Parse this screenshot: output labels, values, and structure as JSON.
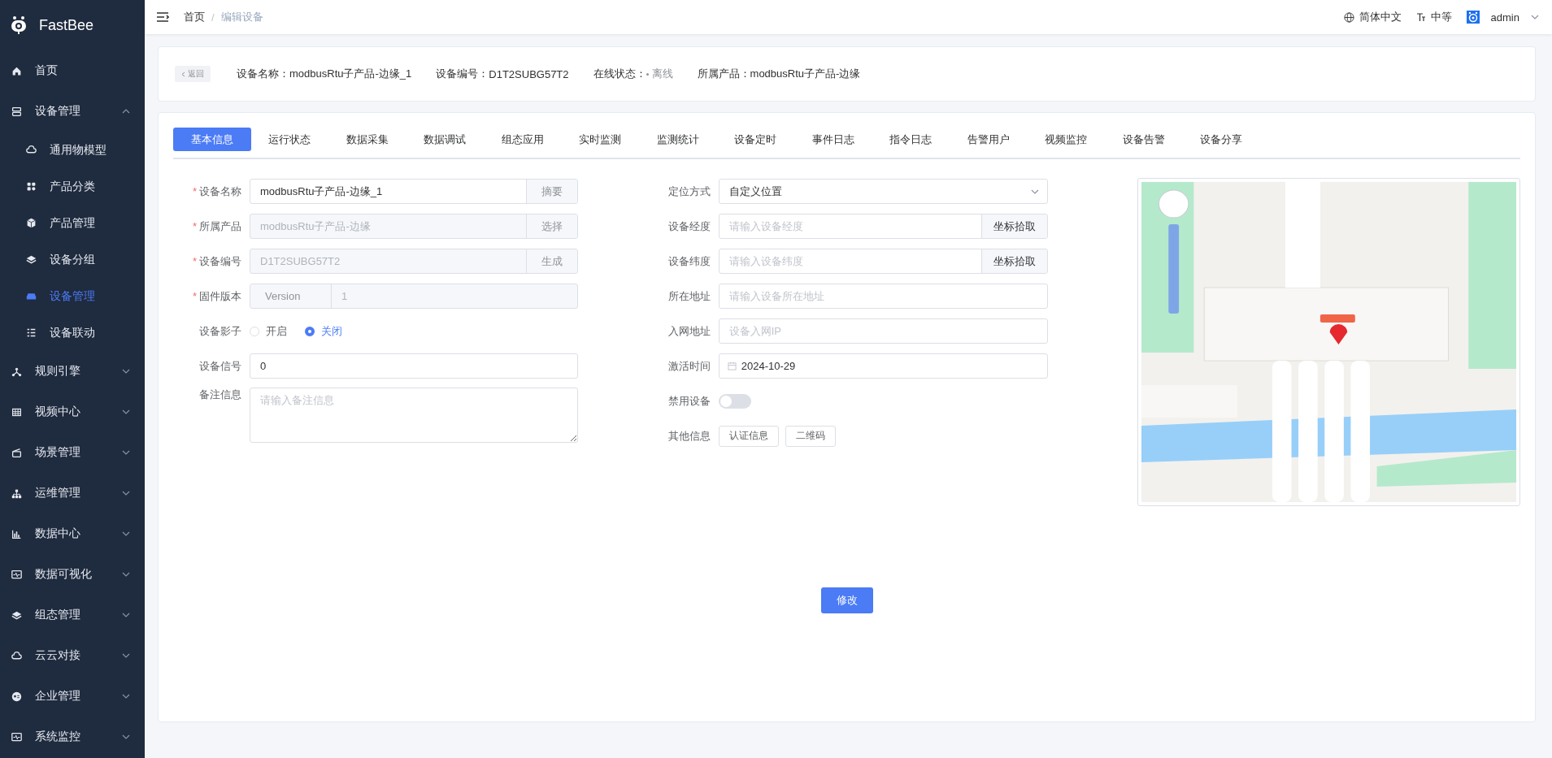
{
  "sidebar": {
    "logo": "FastBee",
    "items": [
      {
        "label": "首页"
      },
      {
        "label": "设备管理",
        "expanded": true,
        "children": [
          {
            "label": "通用物模型",
            "selected": false
          },
          {
            "label": "产品分类",
            "selected": false
          },
          {
            "label": "产品管理",
            "selected": false
          },
          {
            "label": "设备分组",
            "selected": false
          },
          {
            "label": "设备管理",
            "selected": true
          },
          {
            "label": "设备联动",
            "selected": false
          }
        ]
      },
      {
        "label": "规则引擎",
        "expanded": false
      },
      {
        "label": "视频中心",
        "expanded": false
      },
      {
        "label": "场景管理",
        "expanded": false
      },
      {
        "label": "运维管理",
        "expanded": false
      },
      {
        "label": "数据中心",
        "expanded": false
      },
      {
        "label": "数据可视化",
        "expanded": false
      },
      {
        "label": "组态管理",
        "expanded": false
      },
      {
        "label": "云云对接",
        "expanded": false
      },
      {
        "label": "企业管理",
        "expanded": false
      },
      {
        "label": "系统监控",
        "expanded": false
      }
    ]
  },
  "header": {
    "breadcrumb": [
      "首页",
      "编辑设备"
    ],
    "separator": "/",
    "language": "简体中文",
    "size": "中等",
    "user": "admin"
  },
  "device_info": {
    "back": "返回",
    "fields": [
      {
        "label": "设备名称：",
        "value": "modbusRtu子产品-边缘_1",
        "kind": "text"
      },
      {
        "label": "设备编号：",
        "value": "D1T2SUBG57T2",
        "kind": "text"
      },
      {
        "label": "在线状态：",
        "value": "离线",
        "kind": "status"
      },
      {
        "label": "所属产品：",
        "value": "modbusRtu子产品-边缘",
        "kind": "text"
      }
    ]
  },
  "tabs": [
    {
      "label": "基本信息",
      "selected": true
    },
    {
      "label": "运行状态",
      "selected": false
    },
    {
      "label": "数据采集",
      "selected": false
    },
    {
      "label": "数据调试",
      "selected": false
    },
    {
      "label": "组态应用",
      "selected": false
    },
    {
      "label": "实时监测",
      "selected": false
    },
    {
      "label": "监测统计",
      "selected": false
    },
    {
      "label": "设备定时",
      "selected": false
    },
    {
      "label": "事件日志",
      "selected": false
    },
    {
      "label": "指令日志",
      "selected": false
    },
    {
      "label": "告警用户",
      "selected": false
    },
    {
      "label": "视频监控",
      "selected": false
    },
    {
      "label": "设备告警",
      "selected": false
    },
    {
      "label": "设备分享",
      "selected": false
    }
  ],
  "form_left": [
    {
      "kind": "input",
      "label": "设备名称",
      "mark": "*",
      "value": "modbusRtu子产品-边缘_1",
      "disabled": false,
      "append": "摘要"
    },
    {
      "kind": "input",
      "label": "所属产品",
      "mark": "*",
      "value": "modbusRtu子产品-边缘",
      "disabled": true,
      "append": "选择"
    },
    {
      "kind": "input",
      "label": "设备编号",
      "mark": "*",
      "value": "D1T2SUBG57T2",
      "disabled": true,
      "append": "生成"
    },
    {
      "kind": "prepend",
      "label": "固件版本",
      "mark": "*",
      "prepend": "Version",
      "value": "1",
      "disabled": true
    },
    {
      "kind": "radio",
      "label": "设备影子",
      "options": [
        {
          "label": "开启",
          "selected": false
        },
        {
          "label": "关闭",
          "selected": true
        }
      ]
    },
    {
      "kind": "input",
      "label": "设备信号",
      "value": "0",
      "disabled": false
    },
    {
      "kind": "textarea",
      "label": "备注信息",
      "placeholder": "请输入备注信息"
    }
  ],
  "form_right": [
    {
      "kind": "select",
      "label": "定位方式",
      "value": "自定义位置"
    },
    {
      "kind": "input",
      "label": "设备经度",
      "placeholder": "请输入设备经度",
      "append": "坐标拾取"
    },
    {
      "kind": "input",
      "label": "设备纬度",
      "placeholder": "请输入设备纬度",
      "append": "坐标拾取"
    },
    {
      "kind": "input",
      "label": "所在地址",
      "placeholder": "请输入设备所在地址"
    },
    {
      "kind": "input",
      "label": "入网地址",
      "placeholder": "设备入网IP"
    },
    {
      "kind": "date",
      "label": "激活时间",
      "value": "2024-10-29"
    },
    {
      "kind": "switch",
      "label": "禁用设备",
      "on": false
    },
    {
      "kind": "buttons",
      "label": "其他信息",
      "buttons": [
        "认证信息",
        "二维码"
      ]
    }
  ],
  "submit": "修改"
}
